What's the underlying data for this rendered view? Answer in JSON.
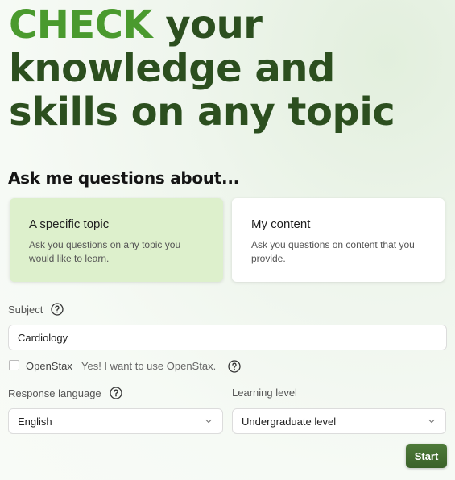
{
  "hero": {
    "accent": "CHECK",
    "line1_rest": " your",
    "line2": "knowledge and",
    "line3": "skills on any topic"
  },
  "ask_heading": "Ask me questions about...",
  "cards": [
    {
      "title": "A specific topic",
      "description": "Ask you questions on any topic you would like to learn.",
      "selected": true
    },
    {
      "title": "My content",
      "description": "Ask you questions on content that you provide.",
      "selected": false
    }
  ],
  "subject": {
    "label": "Subject",
    "value": "Cardiology"
  },
  "openstax": {
    "label": "OpenStax",
    "description": "Yes! I want to use OpenStax.",
    "checked": false
  },
  "response_language": {
    "label": "Response language",
    "value": "English"
  },
  "learning_level": {
    "label": "Learning level",
    "value": "Undergraduate level"
  },
  "start_button": "Start",
  "icons": {
    "help": "help-circle-icon",
    "chevron": "chevron-down-icon"
  },
  "colors": {
    "accent": "#4a9a2e",
    "heading": "#2c4f1f",
    "selected_card": "#ddf0cc",
    "button": "#3b6229"
  }
}
